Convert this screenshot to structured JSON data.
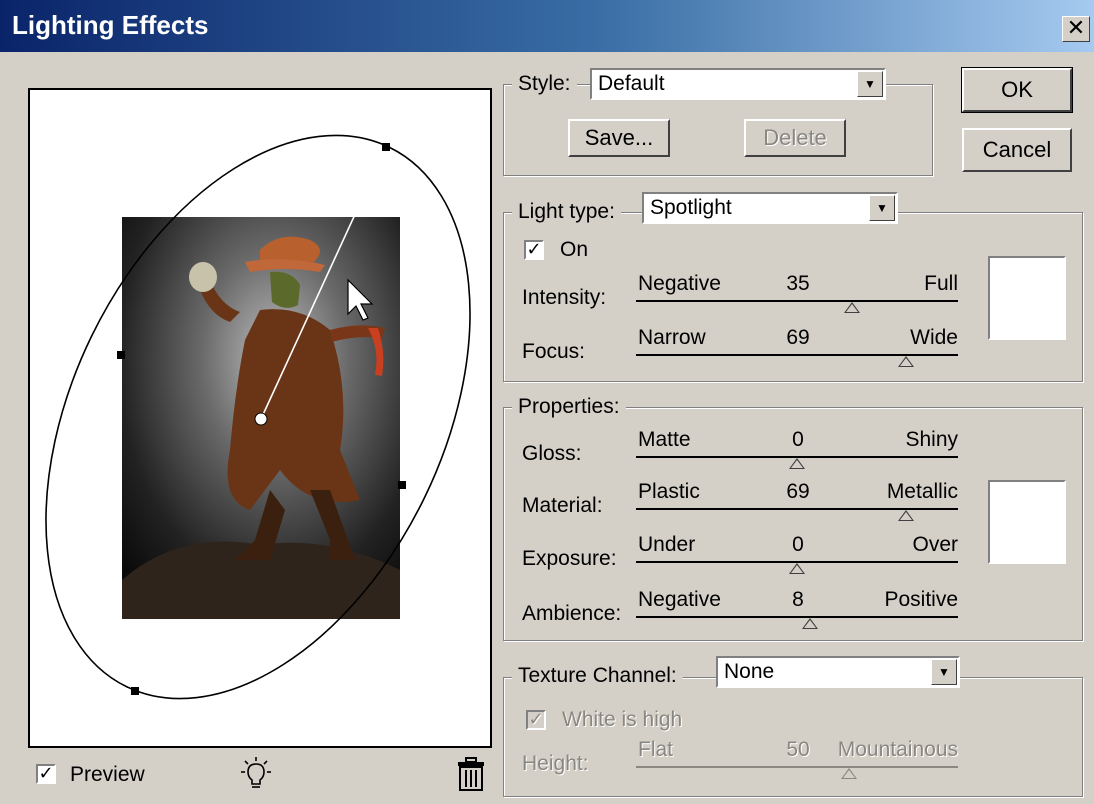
{
  "window": {
    "title": "Lighting Effects",
    "close_label": "✕"
  },
  "buttons": {
    "ok": "OK",
    "cancel": "Cancel",
    "save": "Save...",
    "delete": "Delete"
  },
  "style": {
    "label": "Style:",
    "value": "Default"
  },
  "light_type": {
    "label": "Light type:",
    "value": "Spotlight",
    "on_label": "On",
    "on_checked": true
  },
  "light_sliders": [
    {
      "label": "Intensity:",
      "min": "Negative",
      "value": "35",
      "max": "Full",
      "level": 0.67
    },
    {
      "label": "Focus:",
      "min": "Narrow",
      "value": "69",
      "max": "Wide",
      "level": 0.84
    }
  ],
  "properties": {
    "label": "Properties:",
    "sliders": [
      {
        "label": "Gloss:",
        "min": "Matte",
        "value": "0",
        "max": "Shiny",
        "level": 0.5
      },
      {
        "label": "Material:",
        "min": "Plastic",
        "value": "69",
        "max": "Metallic",
        "level": 0.84
      },
      {
        "label": "Exposure:",
        "min": "Under",
        "value": "0",
        "max": "Over",
        "level": 0.5
      },
      {
        "label": "Ambience:",
        "min": "Negative",
        "value": "8",
        "max": "Positive",
        "level": 0.54
      }
    ]
  },
  "texture": {
    "label": "Texture Channel:",
    "value": "None",
    "white_is_high": "White is high",
    "height": {
      "label": "Height:",
      "min": "Flat",
      "value": "50",
      "max": "Mountainous",
      "level": 0.66
    }
  },
  "preview": {
    "label": "Preview",
    "checked": true
  },
  "icons": {
    "light": "light-bulb-icon",
    "trash": "trash-icon"
  },
  "colors": {
    "titlebar_start": "#0a246a",
    "titlebar_end": "#a6caf0",
    "dialog_bg": "#d4d0c8"
  }
}
